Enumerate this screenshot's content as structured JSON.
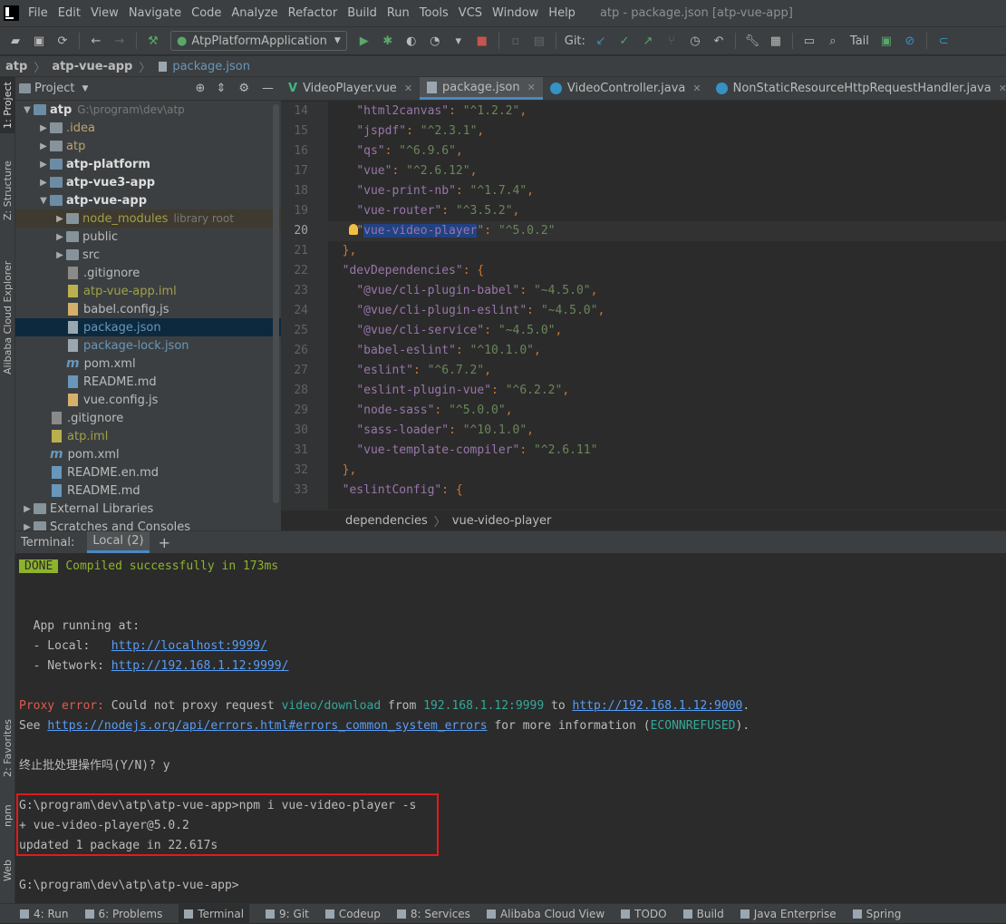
{
  "menu": {
    "items": [
      "File",
      "Edit",
      "View",
      "Navigate",
      "Code",
      "Analyze",
      "Refactor",
      "Build",
      "Run",
      "Tools",
      "VCS",
      "Window",
      "Help"
    ],
    "window_title": "atp - package.json [atp-vue-app]"
  },
  "toolbar": {
    "run_config": "AtpPlatformApplication",
    "git_label": "Git:",
    "tail_label": "Tail"
  },
  "breadcrumb": [
    "atp",
    "atp-vue-app",
    "package.json"
  ],
  "side_tabs": {
    "project": "1: Project",
    "structure": "Z: Structure",
    "alibaba": "Alibaba Cloud Explorer",
    "favorites": "2: Favorites",
    "npm": "npm",
    "web": "Web"
  },
  "project": {
    "title": "Project",
    "tree": [
      {
        "label": "atp",
        "extra": "G:\\program\\dev\\atp",
        "indent": 0,
        "arrow": "down",
        "icon": "module",
        "style": "bold"
      },
      {
        "label": ".idea",
        "indent": 1,
        "arrow": "right",
        "icon": "folder",
        "style": "yellow"
      },
      {
        "label": "atp",
        "indent": 1,
        "arrow": "right",
        "icon": "folder",
        "style": "yellow"
      },
      {
        "label": "atp-platform",
        "indent": 1,
        "arrow": "right",
        "icon": "module",
        "style": "bold"
      },
      {
        "label": "atp-vue3-app",
        "indent": 1,
        "arrow": "right",
        "icon": "module",
        "style": "bold"
      },
      {
        "label": "atp-vue-app",
        "indent": 1,
        "arrow": "down",
        "icon": "module",
        "style": "bold"
      },
      {
        "label": "node_modules",
        "extra": "library root",
        "indent": 2,
        "arrow": "right",
        "icon": "folder",
        "style": "olive",
        "hl": true
      },
      {
        "label": "public",
        "indent": 2,
        "arrow": "right",
        "icon": "folder",
        "style": "white"
      },
      {
        "label": "src",
        "indent": 2,
        "arrow": "right",
        "icon": "folder",
        "style": "white"
      },
      {
        "label": ".gitignore",
        "indent": 2,
        "arrow": "",
        "icon": "git",
        "style": "white"
      },
      {
        "label": "atp-vue-app.iml",
        "indent": 2,
        "arrow": "",
        "icon": "iml",
        "style": "olive"
      },
      {
        "label": "babel.config.js",
        "indent": 2,
        "arrow": "",
        "icon": "js",
        "style": "white"
      },
      {
        "label": "package.json",
        "indent": 2,
        "arrow": "",
        "icon": "json",
        "style": "blue",
        "sel": true
      },
      {
        "label": "package-lock.json",
        "indent": 2,
        "arrow": "",
        "icon": "json",
        "style": "blue"
      },
      {
        "label": "pom.xml",
        "indent": 2,
        "arrow": "",
        "icon": "maven",
        "style": "white"
      },
      {
        "label": "README.md",
        "indent": 2,
        "arrow": "",
        "icon": "md",
        "style": "white"
      },
      {
        "label": "vue.config.js",
        "indent": 2,
        "arrow": "",
        "icon": "js",
        "style": "white"
      },
      {
        "label": ".gitignore",
        "indent": 1,
        "arrow": "",
        "icon": "git",
        "style": "white"
      },
      {
        "label": "atp.iml",
        "indent": 1,
        "arrow": "",
        "icon": "iml",
        "style": "olive"
      },
      {
        "label": "pom.xml",
        "indent": 1,
        "arrow": "",
        "icon": "maven",
        "style": "white"
      },
      {
        "label": "README.en.md",
        "indent": 1,
        "arrow": "",
        "icon": "md",
        "style": "white"
      },
      {
        "label": "README.md",
        "indent": 1,
        "arrow": "",
        "icon": "md",
        "style": "white"
      },
      {
        "label": "External Libraries",
        "indent": 0,
        "arrow": "right",
        "icon": "lib",
        "style": "white"
      },
      {
        "label": "Scratches and Consoles",
        "indent": 0,
        "arrow": "right",
        "icon": "folder",
        "style": "white"
      }
    ]
  },
  "editor": {
    "tabs": [
      {
        "label": "VideoPlayer.vue",
        "icon": "vue",
        "active": false
      },
      {
        "label": "package.json",
        "icon": "json",
        "active": true
      },
      {
        "label": "VideoController.java",
        "icon": "class",
        "active": false
      },
      {
        "label": "NonStaticResourceHttpRequestHandler.java",
        "icon": "class",
        "active": false
      }
    ],
    "lines": [
      {
        "n": "14",
        "key": "html2canvas",
        "val": "^1.2.2",
        "indent": "    ",
        "comma": ","
      },
      {
        "n": "15",
        "key": "jspdf",
        "val": "^2.3.1",
        "indent": "    ",
        "comma": ","
      },
      {
        "n": "16",
        "key": "qs",
        "val": "^6.9.6",
        "indent": "    ",
        "comma": ","
      },
      {
        "n": "17",
        "key": "vue",
        "val": "^2.6.12",
        "indent": "    ",
        "comma": ","
      },
      {
        "n": "18",
        "key": "vue-print-nb",
        "val": "^1.7.4",
        "indent": "    ",
        "comma": ","
      },
      {
        "n": "19",
        "key": "vue-router",
        "val": "^3.5.2",
        "indent": "    ",
        "comma": ","
      },
      {
        "n": "20",
        "key": "vue-video-player",
        "val": "^5.0.2",
        "indent": "    ",
        "comma": "",
        "cur": true,
        "sel": true
      },
      {
        "n": "21",
        "raw": "  },"
      },
      {
        "n": "22",
        "key": "devDependencies",
        "open": "{",
        "indent": "  "
      },
      {
        "n": "23",
        "key": "@vue/cli-plugin-babel",
        "val": "~4.5.0",
        "indent": "    ",
        "comma": ","
      },
      {
        "n": "24",
        "key": "@vue/cli-plugin-eslint",
        "val": "~4.5.0",
        "indent": "    ",
        "comma": ","
      },
      {
        "n": "25",
        "key": "@vue/cli-service",
        "val": "~4.5.0",
        "indent": "    ",
        "comma": ","
      },
      {
        "n": "26",
        "key": "babel-eslint",
        "val": "^10.1.0",
        "indent": "    ",
        "comma": ","
      },
      {
        "n": "27",
        "key": "eslint",
        "val": "^6.7.2",
        "indent": "    ",
        "comma": ","
      },
      {
        "n": "28",
        "key": "eslint-plugin-vue",
        "val": "^6.2.2",
        "indent": "    ",
        "comma": ","
      },
      {
        "n": "29",
        "key": "node-sass",
        "val": "^5.0.0",
        "indent": "    ",
        "comma": ","
      },
      {
        "n": "30",
        "key": "sass-loader",
        "val": "^10.1.0",
        "indent": "    ",
        "comma": ","
      },
      {
        "n": "31",
        "key": "vue-template-compiler",
        "val": "^2.6.11",
        "indent": "    ",
        "comma": ""
      },
      {
        "n": "32",
        "raw": "  },"
      },
      {
        "n": "33",
        "key": "eslintConfig",
        "open": "{",
        "indent": "  "
      }
    ],
    "breadcrumb": [
      "dependencies",
      "vue-video-player"
    ]
  },
  "terminal": {
    "label": "Terminal:",
    "tab": "Local (2)",
    "plus": "+",
    "done_badge": "DONE",
    "compiled": "Compiled successfully in 173ms",
    "app_running": "  App running at:",
    "local_label": "  - Local:   ",
    "local_url": "http://localhost:9999/",
    "network_label": "  - Network: ",
    "network_url": "http://192.168.1.12:9999/",
    "proxy_err_label": "Proxy error:",
    "proxy_text1": " Could not proxy request ",
    "proxy_path": "video/download",
    "proxy_text2": " from ",
    "proxy_host": "192.168.1.12:9999",
    "proxy_text3": " to ",
    "proxy_target": "http://192.168.1.12:9000",
    "proxy_dot": ".",
    "see_text": "See ",
    "see_url": "https://nodejs.org/api/errors.html#errors_common_system_errors",
    "see_text2": " for more information (",
    "see_code": "ECONNREFUSED",
    "see_text3": ").",
    "terminate": "终止批处理操作吗(Y/N)? y",
    "cmd": "G:\\program\\dev\\atp\\atp-vue-app>npm i vue-video-player -s",
    "installed": "+ vue-video-player@5.0.2",
    "updated": "updated 1 package in 22.617s",
    "prompt": "G:\\program\\dev\\atp\\atp-vue-app>"
  },
  "statusbar": [
    {
      "label": "4: Run",
      "icon": "run"
    },
    {
      "label": "6: Problems",
      "icon": "problems"
    },
    {
      "label": "Terminal",
      "icon": "terminal",
      "active": true
    },
    {
      "label": "9: Git",
      "icon": "git"
    },
    {
      "label": "Codeup",
      "icon": "codeup"
    },
    {
      "label": "8: Services",
      "icon": "services"
    },
    {
      "label": "Alibaba Cloud View",
      "icon": "cloud"
    },
    {
      "label": "TODO",
      "icon": "todo"
    },
    {
      "label": "Build",
      "icon": "build"
    },
    {
      "label": "Java Enterprise",
      "icon": "java"
    },
    {
      "label": "Spring",
      "icon": "spring"
    }
  ]
}
